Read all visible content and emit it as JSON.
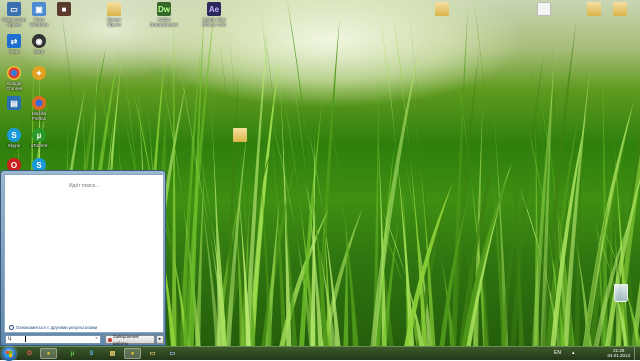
{
  "desktop": {
    "icons": [
      {
        "label": "Компьютер Ярыня",
        "icon": "computer-icon",
        "color": "#3a6fb0"
      },
      {
        "label": "Фото Windows",
        "icon": "photo-icon",
        "color": "#4a8ad0"
      },
      {
        "label": "",
        "icon": "media-icon",
        "color": "#5a3a2a"
      },
      {
        "label": "Ярлык Ярыня",
        "icon": "folder-icon",
        "color": "#d9b44a"
      },
      {
        "label": "Adobe Dreamweaver",
        "icon": "dreamweaver-icon",
        "color": "#35682a"
      },
      {
        "label": "Adobe After Effects CS6",
        "icon": "after-effects-icon",
        "color": "#2a2a5a"
      },
      {
        "label": "",
        "icon": "folder-icon",
        "color": "#d9b44a"
      },
      {
        "label": "",
        "icon": "document-icon",
        "color": "#f4f4f4"
      },
      {
        "label": "",
        "icon": "folder-icon",
        "color": "#d9b44a"
      },
      {
        "label": "",
        "icon": "folder-icon",
        "color": "#d9b44a"
      },
      {
        "label": "Team",
        "icon": "teamviewer-icon",
        "color": "#1e6fd0"
      },
      {
        "label": "Sony",
        "icon": "sony-icon",
        "color": "#333333"
      },
      {
        "label": "Google Chrome",
        "icon": "chrome-icon",
        "color": "#d9413a"
      },
      {
        "label": "",
        "icon": "app-icon",
        "color": "#e0a020"
      },
      {
        "label": "",
        "icon": "mycomputer-icon",
        "color": "#2a6fb0"
      },
      {
        "label": "Mozilla Firefox",
        "icon": "firefox-icon",
        "color": "#e06a20"
      },
      {
        "label": "Skype",
        "icon": "skype-icon",
        "color": "#1a9ad9"
      },
      {
        "label": "uTorrent",
        "icon": "utorrent-icon",
        "color": "#2a9a2a"
      },
      {
        "label": "",
        "icon": "opera-icon",
        "color": "#cc2020"
      },
      {
        "label": "",
        "icon": "skype-icon",
        "color": "#1a9ad9"
      },
      {
        "label": "",
        "icon": "folder-icon",
        "color": "#d9b44a"
      }
    ],
    "recycle_bin_icon": "recycle-bin-icon"
  },
  "start_menu": {
    "searching_text": "Идёт поиск...",
    "more_results": "Ознакомиться с другими результатами",
    "search_value": "Ч",
    "shutdown_label": "Завершение работы",
    "arrow_glyph": "▸"
  },
  "taskbar": {
    "apps": [
      {
        "icon": "opera-icon",
        "glyph": "O",
        "color": "#cc2020"
      },
      {
        "icon": "chrome-icon",
        "glyph": "●",
        "color": "#d9413a"
      },
      {
        "icon": "utorrent-icon",
        "glyph": "µ",
        "color": "#2a9a2a"
      },
      {
        "icon": "skype-icon",
        "glyph": "S",
        "color": "#1a9ad9"
      },
      {
        "icon": "explorer-icon",
        "glyph": "▤",
        "color": "#d9b44a"
      },
      {
        "icon": "chrome-icon",
        "glyph": "●",
        "color": "#d9413a"
      },
      {
        "icon": "folder-icon",
        "glyph": "▭",
        "color": "#d9b44a"
      },
      {
        "icon": "app-icon",
        "glyph": "▭",
        "color": "#6a8ab0"
      }
    ],
    "language": "EN",
    "time": "21:28",
    "date": "04.01.2013"
  }
}
